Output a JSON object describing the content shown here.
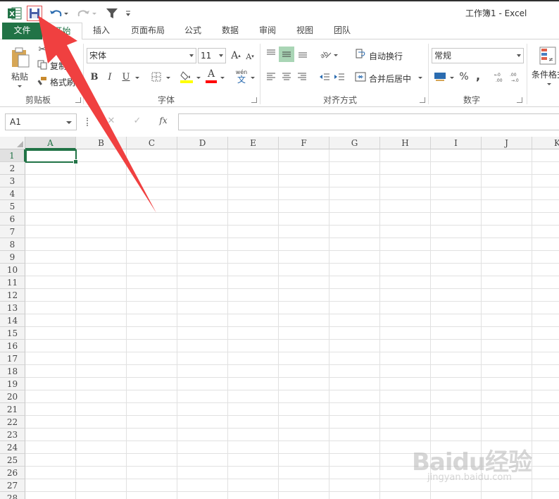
{
  "window": {
    "title": "工作簿1 - Excel"
  },
  "qat": {
    "app_icon": "excel-logo-icon",
    "save": "save-icon",
    "undo": "undo-icon",
    "redo": "redo-icon",
    "filter": "filter-icon",
    "customize": "customize-qat-icon"
  },
  "tabs": [
    {
      "label": "文件"
    },
    {
      "label": "开始"
    },
    {
      "label": "插入"
    },
    {
      "label": "页面布局"
    },
    {
      "label": "公式"
    },
    {
      "label": "数据"
    },
    {
      "label": "审阅"
    },
    {
      "label": "视图"
    },
    {
      "label": "团队"
    }
  ],
  "ribbon": {
    "clipboard": {
      "paste": "粘贴",
      "cut": "剪切",
      "copy": "复制",
      "format_painter": "格式刷",
      "label": "剪贴板"
    },
    "font": {
      "name": "宋体",
      "size": "11",
      "bold": "B",
      "italic": "I",
      "underline": "U",
      "wen": "wén",
      "wen_char": "文",
      "font_color_letter": "A",
      "grow": "A",
      "shrink": "A",
      "label": "字体"
    },
    "alignment": {
      "wrap": "自动换行",
      "merge": "合并后居中",
      "label": "对齐方式"
    },
    "number": {
      "format": "常规",
      "percent": "%",
      "comma": ",",
      "label": "数字"
    },
    "styles": {
      "conditional": "条件格式"
    }
  },
  "formula_bar": {
    "name_box": "A1",
    "cancel": "✕",
    "enter": "✓",
    "fx": "fx",
    "value": ""
  },
  "grid": {
    "columns": [
      "A",
      "B",
      "C",
      "D",
      "E",
      "F",
      "G",
      "H",
      "I",
      "J",
      "K"
    ],
    "rows": [
      "1",
      "2",
      "3",
      "4",
      "5",
      "6",
      "7",
      "8",
      "9",
      "10",
      "11",
      "12",
      "13",
      "14",
      "15",
      "16",
      "17",
      "18",
      "19",
      "20",
      "21",
      "22",
      "23",
      "24",
      "25",
      "26",
      "27",
      "28"
    ],
    "active_cell": "A1"
  },
  "colors": {
    "excel_green": "#217346",
    "arrow_red": "#f04040"
  },
  "watermark": {
    "main": "Baidu经验",
    "sub": "jingyan.baidu.com"
  }
}
